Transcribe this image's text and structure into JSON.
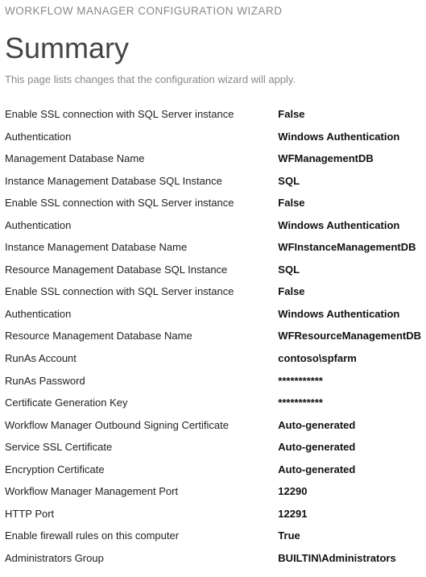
{
  "header": "WORKFLOW MANAGER CONFIGURATION WIZARD",
  "title": "Summary",
  "subtitle": "This page lists changes that the configuration wizard will apply.",
  "settings": [
    {
      "label": "Enable SSL connection with SQL Server instance",
      "value": "False"
    },
    {
      "label": "Authentication",
      "value": "Windows Authentication"
    },
    {
      "label": "Management Database Name",
      "value": "WFManagementDB"
    },
    {
      "label": "Instance Management Database SQL Instance",
      "value": "SQL"
    },
    {
      "label": "Enable SSL connection with SQL Server instance",
      "value": "False"
    },
    {
      "label": "Authentication",
      "value": "Windows Authentication"
    },
    {
      "label": "Instance Management Database Name",
      "value": "WFInstanceManagementDB"
    },
    {
      "label": "Resource Management Database SQL Instance",
      "value": "SQL"
    },
    {
      "label": "Enable SSL connection with SQL Server instance",
      "value": "False"
    },
    {
      "label": "Authentication",
      "value": "Windows Authentication"
    },
    {
      "label": "Resource Management Database Name",
      "value": "WFResourceManagementDB"
    },
    {
      "label": "RunAs Account",
      "value": "contoso\\spfarm"
    },
    {
      "label": "RunAs Password",
      "value": "***********"
    },
    {
      "label": "Certificate Generation Key",
      "value": "***********"
    },
    {
      "label": "Workflow Manager Outbound Signing Certificate",
      "value": "Auto-generated"
    },
    {
      "label": "Service SSL Certificate",
      "value": "Auto-generated"
    },
    {
      "label": "Encryption Certificate",
      "value": "Auto-generated"
    },
    {
      "label": "Workflow Manager Management Port",
      "value": "12290"
    },
    {
      "label": "HTTP Port",
      "value": "12291"
    },
    {
      "label": "Enable firewall rules on this computer",
      "value": "True"
    },
    {
      "label": "Administrators Group",
      "value": "BUILTIN\\Administrators"
    }
  ]
}
